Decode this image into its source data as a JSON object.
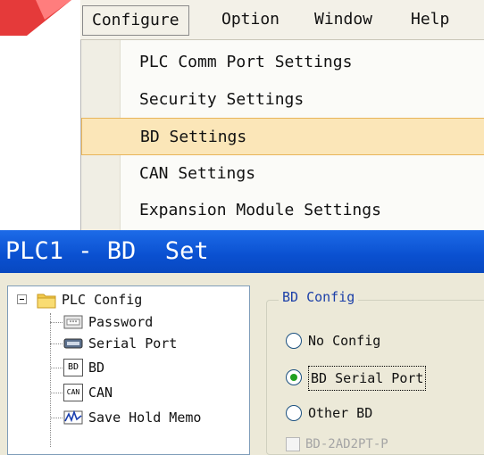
{
  "menubar": {
    "items": [
      {
        "label": "Configure",
        "active": true
      },
      {
        "label": "Option"
      },
      {
        "label": "Window"
      },
      {
        "label": "Help"
      }
    ]
  },
  "dropdown": {
    "items": [
      {
        "label": "PLC Comm Port Settings"
      },
      {
        "label": "Security Settings"
      },
      {
        "label": "BD Settings",
        "highlighted": true
      },
      {
        "label": "CAN Settings"
      },
      {
        "label": "Expansion Module Settings"
      }
    ]
  },
  "window": {
    "title": "PLC1 - BD  Set"
  },
  "tree": {
    "root": {
      "label": "PLC Config",
      "icon": "folder-icon",
      "expander": "minus"
    },
    "children": [
      {
        "label": "Password",
        "icon": "password-icon"
      },
      {
        "label": "Serial Port",
        "icon": "serial-port-icon"
      },
      {
        "label": "BD",
        "icon": "bd-icon",
        "icon_text": "BD"
      },
      {
        "label": "CAN",
        "icon": "can-icon",
        "icon_text": "CAN"
      },
      {
        "label": "Save Hold Memo",
        "icon": "save-hold-memory-icon"
      }
    ]
  },
  "bd_config": {
    "legend": "BD Config",
    "options": [
      {
        "label": "No Config",
        "checked": false
      },
      {
        "label": "BD Serial Port",
        "checked": true
      },
      {
        "label": "Other BD",
        "checked": false
      }
    ],
    "checkbox": {
      "label": "BD-2AD2PT-P",
      "checked": false,
      "enabled": false
    }
  },
  "colors": {
    "title_bar": "#0a50d0",
    "menu_highlight": "#fbe6b8",
    "radio_dot": "#21a121",
    "legend_text": "#1b3fa8"
  }
}
